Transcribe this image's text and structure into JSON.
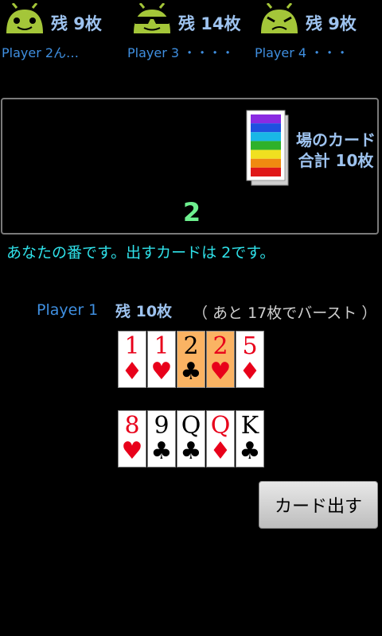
{
  "opponents": [
    {
      "name": "Player 2ん…",
      "count": "残  9枚",
      "face": "normal"
    },
    {
      "name": "Player 3 ・・・・",
      "count": "残 14枚",
      "face": "sunglasses"
    },
    {
      "name": "Player 4 ・・・",
      "count": "残  9枚",
      "face": "frown"
    }
  ],
  "field": {
    "label_line1": "場のカード",
    "label_line2": "合計 10枚",
    "current_number": "2",
    "deck_colors": [
      "#8a2be2",
      "#1f50e0",
      "#19b7e6",
      "#2fb12a",
      "#f0e020",
      "#f08a10",
      "#e01818"
    ]
  },
  "turn_message": "あなたの番です。出すカードは  2です。",
  "player": {
    "name": "Player 1",
    "count": "残 10枚",
    "bust": "（ あと 17枚でバースト ）"
  },
  "hand_row1": [
    {
      "rank": "1",
      "suit": "♦",
      "color": "red",
      "selected": false
    },
    {
      "rank": "1",
      "suit": "♥",
      "color": "red",
      "selected": false
    },
    {
      "rank": "2",
      "suit": "♣",
      "color": "black",
      "selected": true
    },
    {
      "rank": "2",
      "suit": "♥",
      "color": "red",
      "selected": true
    },
    {
      "rank": "5",
      "suit": "♦",
      "color": "red",
      "selected": false
    }
  ],
  "hand_row2": [
    {
      "rank": "8",
      "suit": "♥",
      "color": "red",
      "selected": false
    },
    {
      "rank": "9",
      "suit": "♣",
      "color": "black",
      "selected": false
    },
    {
      "rank": "Q",
      "suit": "♣",
      "color": "black",
      "selected": false
    },
    {
      "rank": "Q",
      "suit": "♦",
      "color": "red",
      "selected": false
    },
    {
      "rank": "K",
      "suit": "♣",
      "color": "black",
      "selected": false
    }
  ],
  "play_button": "カード出す"
}
